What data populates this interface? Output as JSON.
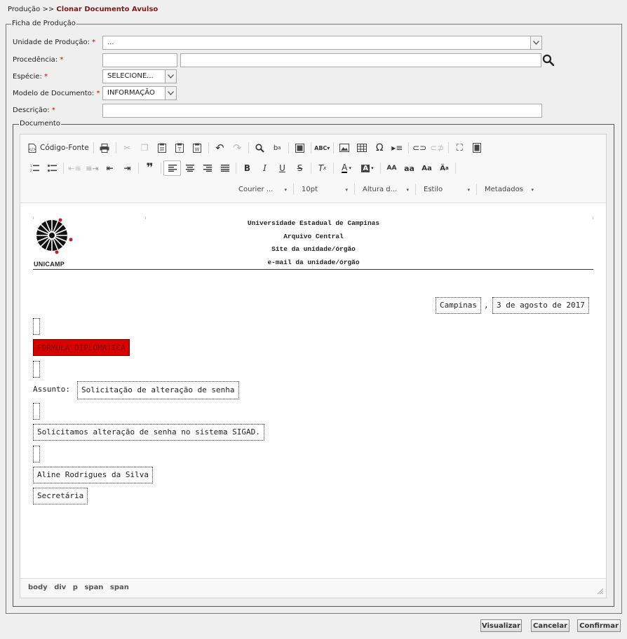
{
  "breadcrumb": {
    "parent": "Produção >>",
    "current": "Clonar Documento Avulso"
  },
  "form": {
    "legend": "Ficha de Produção",
    "unidade_label": "Unidade de Produção:",
    "unidade_value": "...",
    "procedencia_label": "Procedência:",
    "especie_label": "Espécie:",
    "especie_value": "SELECIONE...",
    "modelo_label": "Modelo de Documento:",
    "modelo_value": "INFORMAÇÃO",
    "descricao_label": "Descrição:",
    "required_mark": "*"
  },
  "documento": {
    "legend": "Documento",
    "toolbar": {
      "source_label": "Código-Fonte",
      "font_combo": "Courier ...",
      "size_combo": "10pt",
      "height_combo": "Altura d...",
      "style_combo": "Estilo",
      "meta_combo": "Metadados"
    },
    "header": {
      "logo_text": "UNICAMP",
      "line1": "Universidade Estadual de Campinas",
      "line2": "Arquivo Central",
      "line3": "Site da unidade/órgão",
      "line4": "e-mail da unidade/órgão"
    },
    "body": {
      "city": "Campinas",
      "comma": ",",
      "date": "3 de agosto de 2017",
      "formula": "FORMULA_DIPLOMATICA",
      "assunto_label": "Assunto:",
      "assunto_value": "Solicitação de alteração de senha",
      "paragraph": "Solicitamos alteração de senha no sistema SIGAD.",
      "signer_name": "Aline Rodrigues da Silva",
      "signer_role": "Secretária"
    },
    "status_path": [
      "body",
      "div",
      "p",
      "span",
      "span"
    ]
  },
  "buttons": {
    "visualizar": "Visualizar",
    "cancelar": "Cancelar",
    "confirmar": "Confirmar"
  }
}
